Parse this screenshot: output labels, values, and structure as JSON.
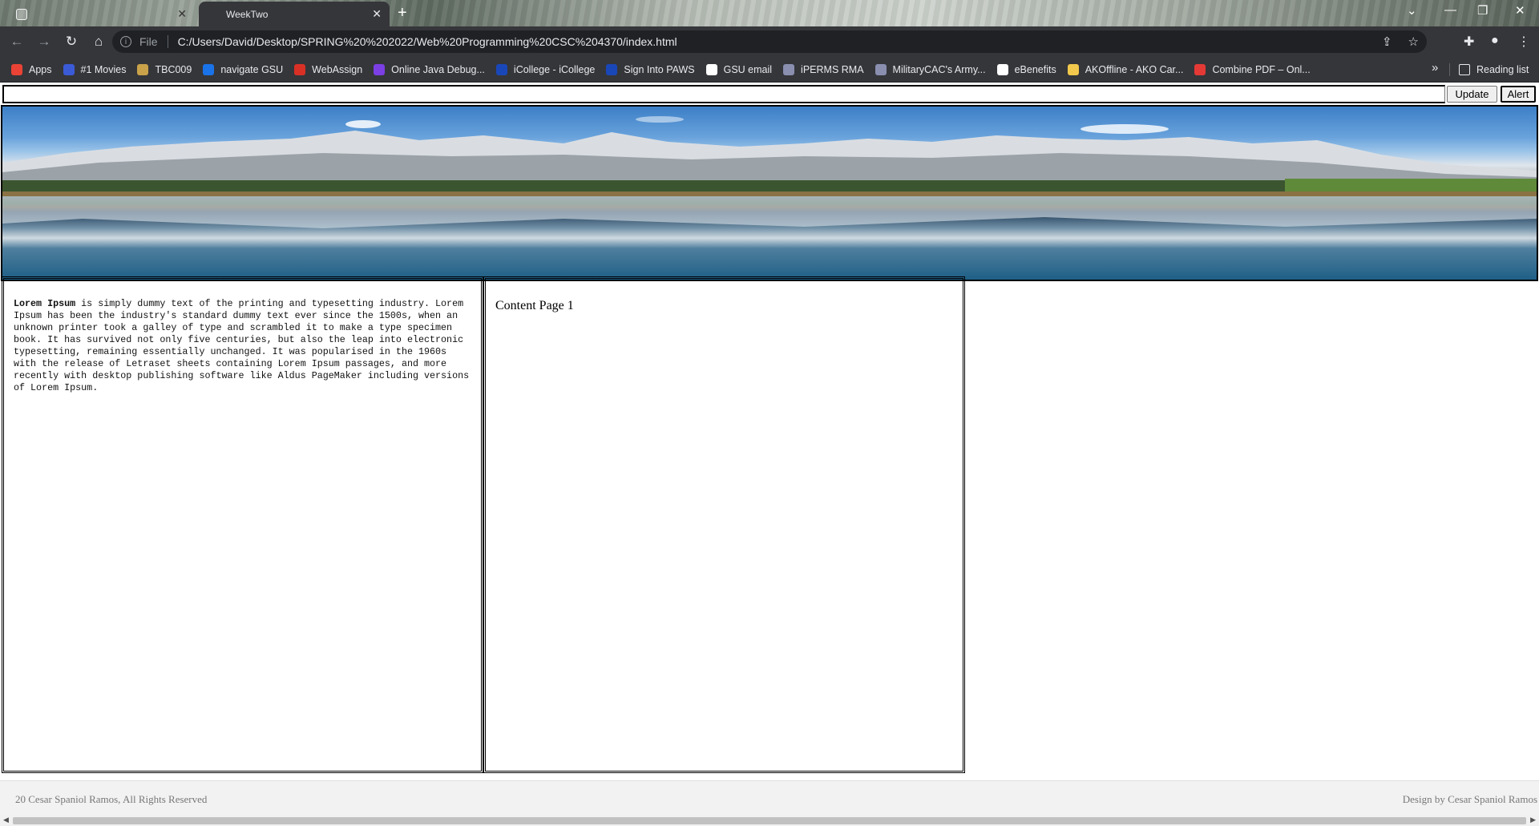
{
  "browser": {
    "inactive_tab_title": "",
    "active_tab_title": "WeekTwo",
    "tab_close": "✕",
    "new_tab": "+",
    "scheme_label": "File",
    "url": "C:/Users/David/Desktop/SPRING%20%202022/Web%20Programming%20CSC%204370/index.html",
    "bookmarks": [
      {
        "label": "Apps",
        "color": "#ea4335",
        "icon": "apps-grid-icon"
      },
      {
        "label": "#1 Movies",
        "color": "#3b5bd6",
        "icon": "movies-icon"
      },
      {
        "label": "TBC009",
        "color": "#c9a24a",
        "icon": "tbc-icon"
      },
      {
        "label": "navigate GSU",
        "color": "#1a73e8",
        "icon": "gsu-icon"
      },
      {
        "label": "WebAssign",
        "color": "#d93025",
        "icon": "webassign-icon"
      },
      {
        "label": "Online Java Debug...",
        "color": "#7b3fe4",
        "icon": "java-debug-icon"
      },
      {
        "label": "iCollege - iCollege",
        "color": "#1a47b8",
        "icon": "icollege-icon"
      },
      {
        "label": "Sign Into PAWS",
        "color": "#1a47b8",
        "icon": "paws-icon"
      },
      {
        "label": "GSU email",
        "color": "#ffffff",
        "icon": "email-icon"
      },
      {
        "label": "iPERMS RMA",
        "color": "#8a8fb0",
        "icon": "iperms-icon"
      },
      {
        "label": "MilitaryCAC's Army...",
        "color": "#8a8fb0",
        "icon": "militarycac-icon"
      },
      {
        "label": "eBenefits",
        "color": "#ffffff",
        "icon": "ebenefits-icon"
      },
      {
        "label": "AKOffline - AKO Car...",
        "color": "#f2c94c",
        "icon": "akoffline-icon"
      },
      {
        "label": "Combine PDF – Onl...",
        "color": "#e53935",
        "icon": "pdf-icon"
      }
    ],
    "more_bookmarks": "»",
    "reading_list": "Reading list"
  },
  "page": {
    "search_value": "",
    "update_label": "Update",
    "alert_label": "Alert",
    "lorem_bold": "Lorem Ipsum",
    "lorem_text": " is simply dummy text of the printing and typesetting industry. Lorem Ipsum has been the industry's standard dummy text ever since the 1500s, when an unknown printer took a galley of type and scrambled it to make a type specimen book. It has survived not only five centuries, but also the leap into electronic typesetting, remaining essentially unchanged. It was popularised in the 1960s with the release of Letraset sheets containing Lorem Ipsum passages, and more recently with desktop publishing software like Aldus PageMaker including versions of Lorem Ipsum.",
    "content_title": "Content Page 1",
    "footer_left": "20 Cesar Spaniol Ramos, All Rights Reserved",
    "footer_right": "Design by Cesar Spaniol Ramos"
  }
}
